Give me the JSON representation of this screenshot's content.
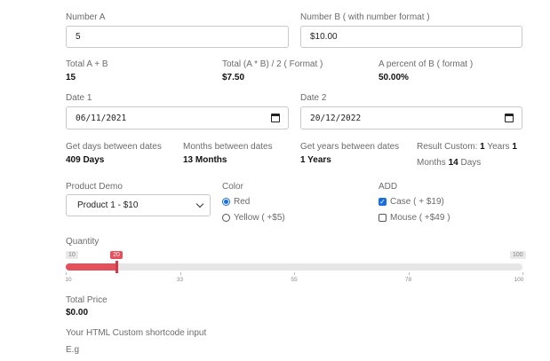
{
  "number_a": {
    "label": "Number A",
    "value": "5"
  },
  "number_b": {
    "label": "Number B ( with number format )",
    "value": "$10.00"
  },
  "totals": {
    "sum_label": "Total A + B",
    "sum_value": "15",
    "product_label": "Total (A * B) / 2 ( Format )",
    "product_value": "$7.50",
    "percent_label": "A percent of B ( format )",
    "percent_value": "50.00%"
  },
  "date1": {
    "label": "Date 1",
    "value": "06/11/2021"
  },
  "date2": {
    "label": "Date 2",
    "value": "20/12/2022"
  },
  "between": {
    "days_label": "Get days between dates",
    "days_value": "409 Days",
    "months_label": "Months between dates",
    "months_value": "13 Months",
    "years_label": "Get years between dates",
    "years_value": "1 Years",
    "custom_label": "Result Custom:",
    "custom_years_num": "1",
    "custom_years_word": "Years",
    "custom_months_num": "1",
    "custom_months_word": "Months",
    "custom_days_num": "14",
    "custom_days_word": "Days"
  },
  "product": {
    "label": "Product Demo",
    "selected": "Product 1 - $10"
  },
  "color": {
    "label": "Color",
    "options": [
      "Red",
      "Yellow ( +$5)"
    ],
    "selected_index": 0
  },
  "add": {
    "label": "ADD",
    "options": [
      "Case ( + $19)",
      "Mouse ( +$49 )"
    ],
    "checked": [
      true,
      false
    ]
  },
  "quantity": {
    "label": "Quantity",
    "min": 10,
    "max": 100,
    "value": 20,
    "min_label": "10",
    "max_label": "100",
    "value_label": "20",
    "ticks": [
      "10",
      "33",
      "55",
      "78",
      "100"
    ]
  },
  "total_price": {
    "label": "Total Price",
    "value": "$0.00"
  },
  "shortcode": {
    "label": "Your HTML Custom shortcode input",
    "example": "E.g"
  },
  "colors": {
    "accent": "#1a6fe0",
    "slider": "#e5505d"
  }
}
